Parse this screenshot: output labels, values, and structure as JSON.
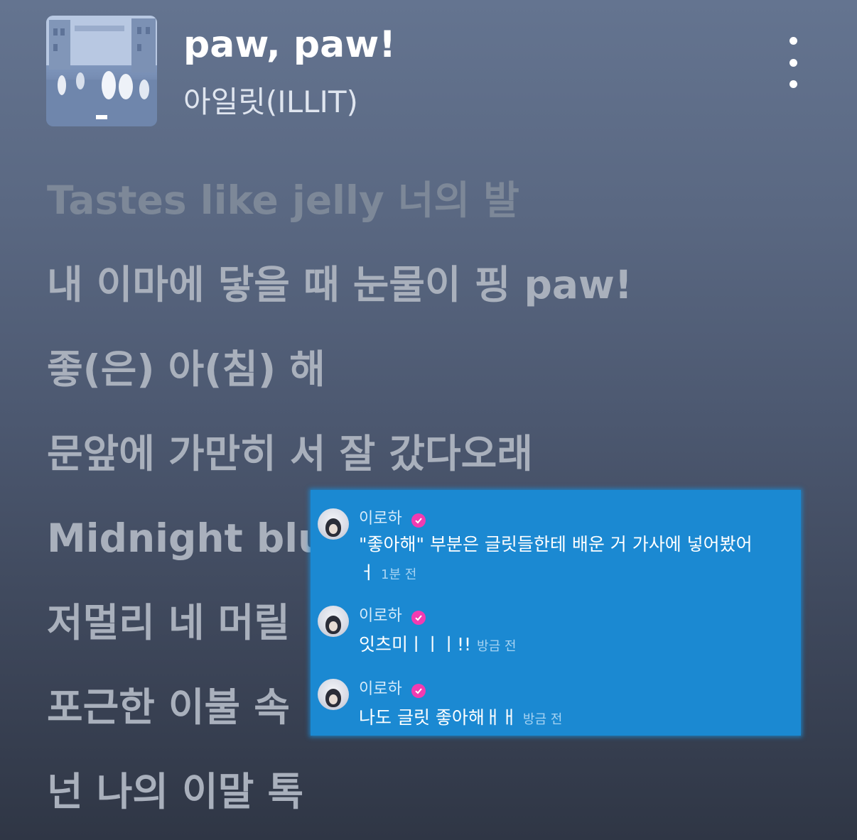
{
  "colors": {
    "background_top": "#647490",
    "background_bottom": "#2f3645",
    "comment_panel": "#1b89d2",
    "verified_badge": "#f23bb1"
  },
  "header": {
    "title": "paw, paw!",
    "artist": "아일릿(ILLIT)",
    "album_art_icon": "album-cover-image",
    "more_icon": "vertical-ellipsis-icon"
  },
  "lyrics": [
    "Tastes like jelly 너의 발",
    "내 이마에 닿을 때 눈물이 핑 paw!",
    "좋(은) 아(침) 해",
    "문앞에 가만히 서 잘 갔다오래",
    "Midnight blue",
    "저멀리 네 머릴",
    "포근한 이불 속",
    "넌 나의 이말 톡"
  ],
  "comments": [
    {
      "author": "이로하",
      "text_line1": "\"좋아해\" 부분은 글릿들한테 배운 거 가사에 넣어봤어",
      "text_line2": "ㅓ",
      "time": "1분 전"
    },
    {
      "author": "이로하",
      "text": "잇츠미ㅣㅣㅣ!!",
      "time": "방금 전"
    },
    {
      "author": "이로하",
      "text": "나도 글릿 좋아해ㅐㅐ",
      "time": "방금 전"
    }
  ]
}
